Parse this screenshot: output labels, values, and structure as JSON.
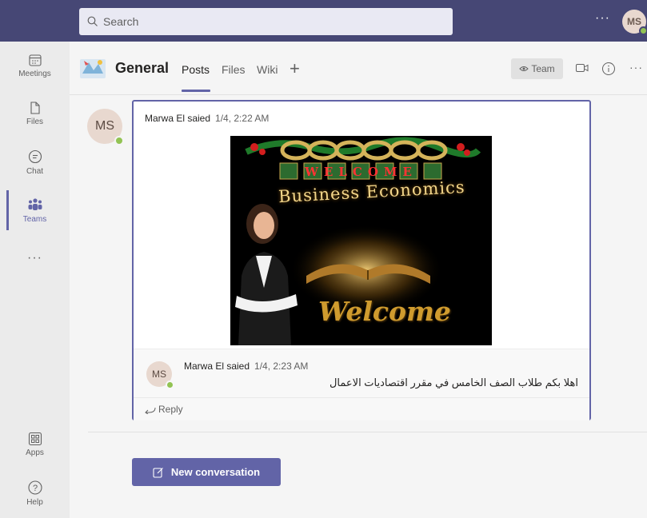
{
  "search": {
    "placeholder": "Search"
  },
  "user": {
    "initials": "MS"
  },
  "rail": {
    "items": [
      {
        "label": "Meetings",
        "icon": "calendar-icon"
      },
      {
        "label": "Files",
        "icon": "file-icon"
      },
      {
        "label": "Chat",
        "icon": "chat-icon"
      },
      {
        "label": "Teams",
        "icon": "teams-icon"
      },
      {
        "label": "Apps",
        "icon": "apps-icon"
      },
      {
        "label": "Help",
        "icon": "help-icon"
      }
    ]
  },
  "channel": {
    "name": "General",
    "tabs": [
      {
        "label": "Posts"
      },
      {
        "label": "Files"
      },
      {
        "label": "Wiki"
      }
    ],
    "team_button": "Team"
  },
  "post": {
    "author": "Marwa El saied",
    "time": "1/4, 2:22 AM",
    "avatar_initials": "MS",
    "image_text": {
      "banner": "WELCOME",
      "subtitle": "Business Economics",
      "footer": "Welcome"
    },
    "reply": {
      "author": "Marwa El saied",
      "time": "1/4, 2:23 AM",
      "avatar_initials": "MS",
      "text": "اهلا بكم طلاب الصف الخامس في مقرر اقتصاديات الاعمال"
    },
    "reply_link": "Reply"
  },
  "new_conversation": "New conversation",
  "colors": {
    "brand": "#6264a7",
    "topbar": "#464775",
    "presence": "#92c353"
  }
}
